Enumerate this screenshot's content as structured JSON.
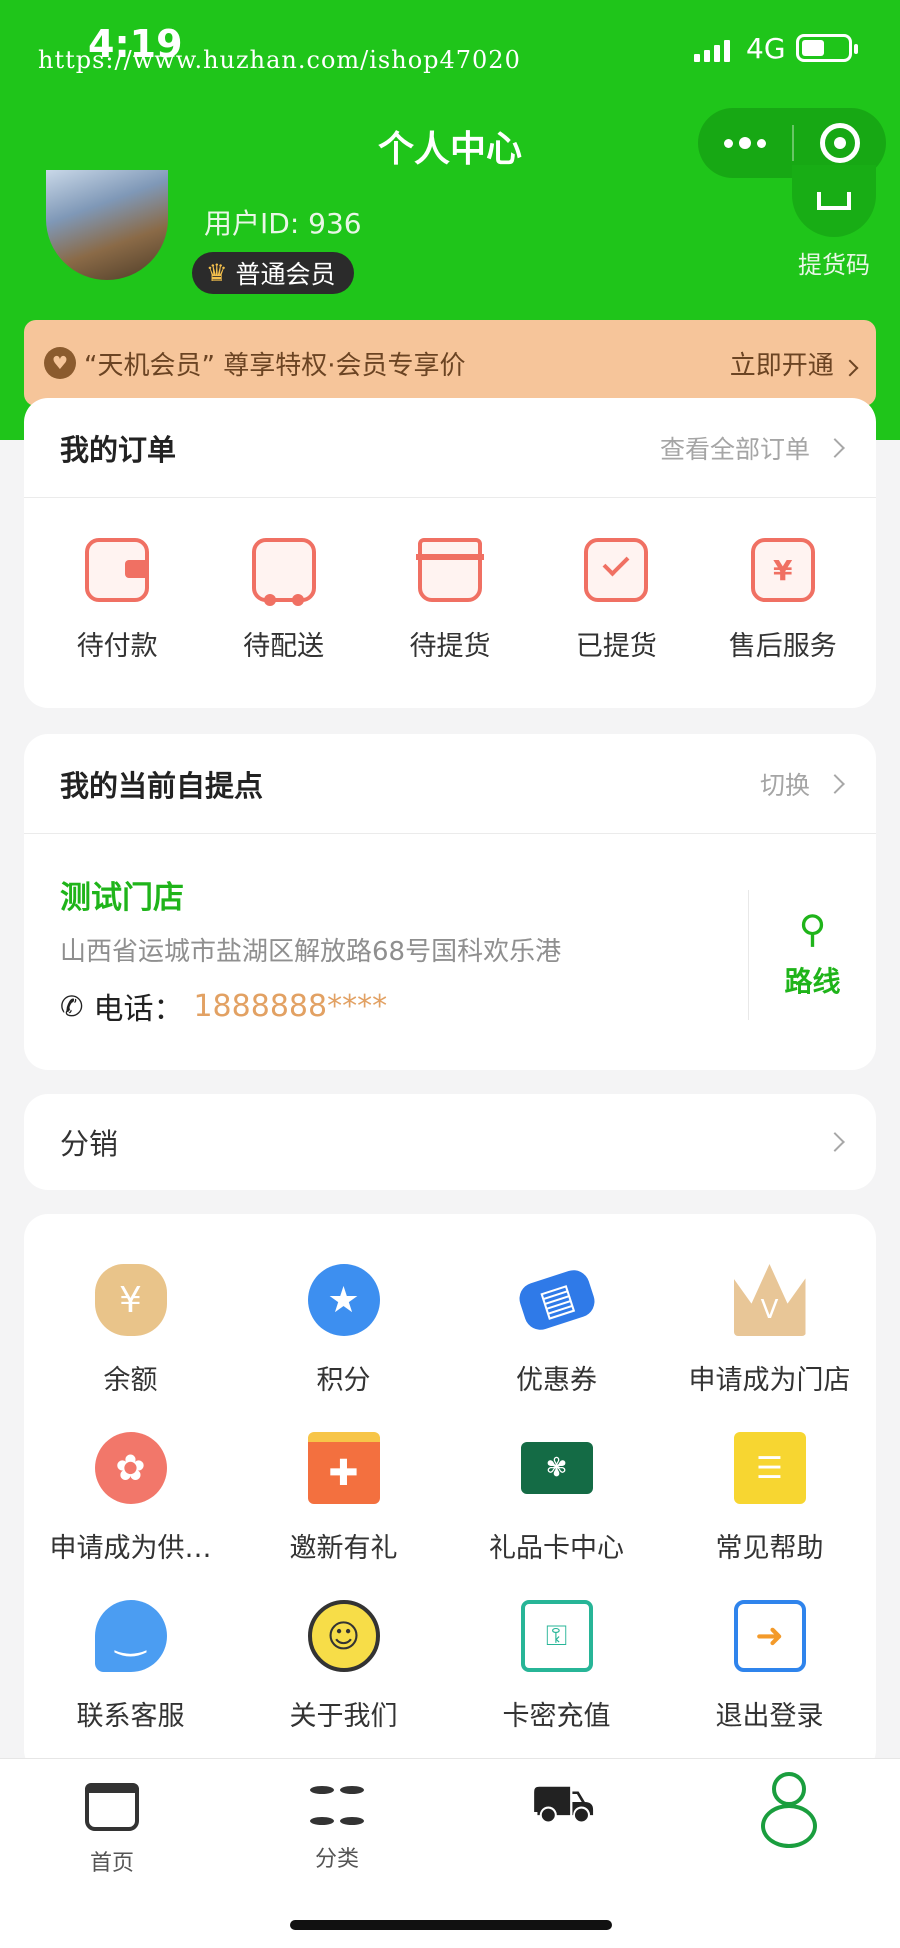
{
  "status_bar": {
    "time": "4:19",
    "watermark": "https://www.huzhan.com/ishop47020",
    "network": "4G"
  },
  "nav": {
    "title": "个人中心"
  },
  "user": {
    "id_text": "用户ID: 936",
    "member_level": "普通会员",
    "qr_label": "提货码"
  },
  "vip_bar": {
    "text": "“天机会员” 尊享特权·会员专享价",
    "action": "立即开通"
  },
  "orders": {
    "title": "我的订单",
    "view_all": "查看全部订单",
    "items": [
      {
        "label": "待付款",
        "icon": "wallet-icon"
      },
      {
        "label": "待配送",
        "icon": "truck-icon"
      },
      {
        "label": "待提货",
        "icon": "gift-box-icon"
      },
      {
        "label": "已提货",
        "icon": "check-clipboard-icon"
      },
      {
        "label": "售后服务",
        "icon": "refund-icon"
      }
    ]
  },
  "pickup": {
    "title": "我的当前自提点",
    "switch": "切换",
    "store_name": "测试门店",
    "address": "山西省运城市盐湖区解放路68号国科欢乐港",
    "phone_label": "电话：",
    "phone": "1888888****",
    "route_label": "路线"
  },
  "distribution": {
    "label": "分销"
  },
  "services": [
    {
      "label": "余额",
      "icon": "money-bag-icon",
      "color": "#e9c48a"
    },
    {
      "label": "积分",
      "icon": "medal-icon",
      "color": "#3d8ff0"
    },
    {
      "label": "优惠券",
      "icon": "coupon-icon",
      "color": "#2f7ae8"
    },
    {
      "label": "申请成为门店",
      "icon": "crown-icon",
      "color": "#e8c697"
    },
    {
      "label": "申请成为供…",
      "icon": "ribbon-icon",
      "color": "#f2776a"
    },
    {
      "label": "邀新有礼",
      "icon": "gift-icon",
      "color": "#f3703f"
    },
    {
      "label": "礼品卡中心",
      "icon": "gift-card-icon",
      "color": "#146b45"
    },
    {
      "label": "常见帮助",
      "icon": "help-note-icon",
      "color": "#f7d631"
    },
    {
      "label": "联系客服",
      "icon": "chat-bubble-icon",
      "color": "#4b9df2"
    },
    {
      "label": "关于我们",
      "icon": "smiley-icon",
      "color": "#f7dd48"
    },
    {
      "label": "卡密充值",
      "icon": "card-key-icon",
      "color": "#27b597"
    },
    {
      "label": "退出登录",
      "icon": "logout-icon",
      "color": "#2f84ec"
    }
  ],
  "tabbar": [
    {
      "label": "首页",
      "icon": "store-icon"
    },
    {
      "label": "分类",
      "icon": "category-icon"
    },
    {
      "label": "",
      "icon": "cart-icon"
    },
    {
      "label": "",
      "icon": "profile-icon"
    }
  ]
}
